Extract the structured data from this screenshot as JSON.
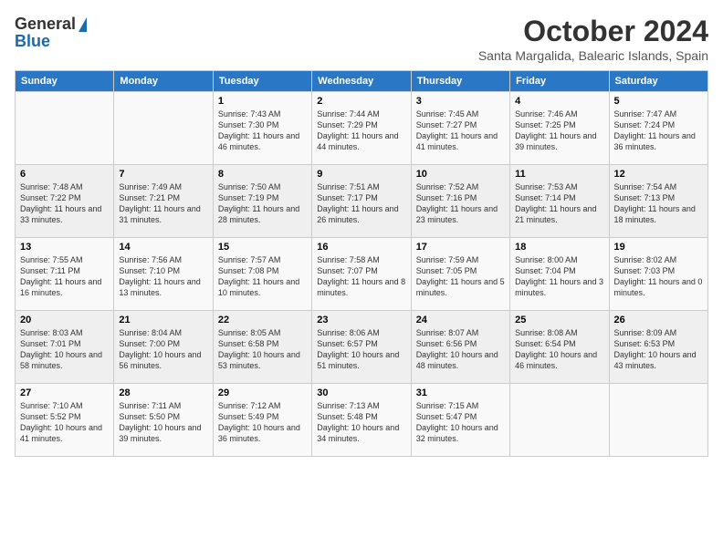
{
  "header": {
    "logo_general": "General",
    "logo_blue": "Blue",
    "month_title": "October 2024",
    "location": "Santa Margalida, Balearic Islands, Spain"
  },
  "days_of_week": [
    "Sunday",
    "Monday",
    "Tuesday",
    "Wednesday",
    "Thursday",
    "Friday",
    "Saturday"
  ],
  "weeks": [
    [
      {
        "day": "",
        "info": ""
      },
      {
        "day": "",
        "info": ""
      },
      {
        "day": "1",
        "info": "Sunrise: 7:43 AM\nSunset: 7:30 PM\nDaylight: 11 hours and 46 minutes."
      },
      {
        "day": "2",
        "info": "Sunrise: 7:44 AM\nSunset: 7:29 PM\nDaylight: 11 hours and 44 minutes."
      },
      {
        "day": "3",
        "info": "Sunrise: 7:45 AM\nSunset: 7:27 PM\nDaylight: 11 hours and 41 minutes."
      },
      {
        "day": "4",
        "info": "Sunrise: 7:46 AM\nSunset: 7:25 PM\nDaylight: 11 hours and 39 minutes."
      },
      {
        "day": "5",
        "info": "Sunrise: 7:47 AM\nSunset: 7:24 PM\nDaylight: 11 hours and 36 minutes."
      }
    ],
    [
      {
        "day": "6",
        "info": "Sunrise: 7:48 AM\nSunset: 7:22 PM\nDaylight: 11 hours and 33 minutes."
      },
      {
        "day": "7",
        "info": "Sunrise: 7:49 AM\nSunset: 7:21 PM\nDaylight: 11 hours and 31 minutes."
      },
      {
        "day": "8",
        "info": "Sunrise: 7:50 AM\nSunset: 7:19 PM\nDaylight: 11 hours and 28 minutes."
      },
      {
        "day": "9",
        "info": "Sunrise: 7:51 AM\nSunset: 7:17 PM\nDaylight: 11 hours and 26 minutes."
      },
      {
        "day": "10",
        "info": "Sunrise: 7:52 AM\nSunset: 7:16 PM\nDaylight: 11 hours and 23 minutes."
      },
      {
        "day": "11",
        "info": "Sunrise: 7:53 AM\nSunset: 7:14 PM\nDaylight: 11 hours and 21 minutes."
      },
      {
        "day": "12",
        "info": "Sunrise: 7:54 AM\nSunset: 7:13 PM\nDaylight: 11 hours and 18 minutes."
      }
    ],
    [
      {
        "day": "13",
        "info": "Sunrise: 7:55 AM\nSunset: 7:11 PM\nDaylight: 11 hours and 16 minutes."
      },
      {
        "day": "14",
        "info": "Sunrise: 7:56 AM\nSunset: 7:10 PM\nDaylight: 11 hours and 13 minutes."
      },
      {
        "day": "15",
        "info": "Sunrise: 7:57 AM\nSunset: 7:08 PM\nDaylight: 11 hours and 10 minutes."
      },
      {
        "day": "16",
        "info": "Sunrise: 7:58 AM\nSunset: 7:07 PM\nDaylight: 11 hours and 8 minutes."
      },
      {
        "day": "17",
        "info": "Sunrise: 7:59 AM\nSunset: 7:05 PM\nDaylight: 11 hours and 5 minutes."
      },
      {
        "day": "18",
        "info": "Sunrise: 8:00 AM\nSunset: 7:04 PM\nDaylight: 11 hours and 3 minutes."
      },
      {
        "day": "19",
        "info": "Sunrise: 8:02 AM\nSunset: 7:03 PM\nDaylight: 11 hours and 0 minutes."
      }
    ],
    [
      {
        "day": "20",
        "info": "Sunrise: 8:03 AM\nSunset: 7:01 PM\nDaylight: 10 hours and 58 minutes."
      },
      {
        "day": "21",
        "info": "Sunrise: 8:04 AM\nSunset: 7:00 PM\nDaylight: 10 hours and 56 minutes."
      },
      {
        "day": "22",
        "info": "Sunrise: 8:05 AM\nSunset: 6:58 PM\nDaylight: 10 hours and 53 minutes."
      },
      {
        "day": "23",
        "info": "Sunrise: 8:06 AM\nSunset: 6:57 PM\nDaylight: 10 hours and 51 minutes."
      },
      {
        "day": "24",
        "info": "Sunrise: 8:07 AM\nSunset: 6:56 PM\nDaylight: 10 hours and 48 minutes."
      },
      {
        "day": "25",
        "info": "Sunrise: 8:08 AM\nSunset: 6:54 PM\nDaylight: 10 hours and 46 minutes."
      },
      {
        "day": "26",
        "info": "Sunrise: 8:09 AM\nSunset: 6:53 PM\nDaylight: 10 hours and 43 minutes."
      }
    ],
    [
      {
        "day": "27",
        "info": "Sunrise: 7:10 AM\nSunset: 5:52 PM\nDaylight: 10 hours and 41 minutes."
      },
      {
        "day": "28",
        "info": "Sunrise: 7:11 AM\nSunset: 5:50 PM\nDaylight: 10 hours and 39 minutes."
      },
      {
        "day": "29",
        "info": "Sunrise: 7:12 AM\nSunset: 5:49 PM\nDaylight: 10 hours and 36 minutes."
      },
      {
        "day": "30",
        "info": "Sunrise: 7:13 AM\nSunset: 5:48 PM\nDaylight: 10 hours and 34 minutes."
      },
      {
        "day": "31",
        "info": "Sunrise: 7:15 AM\nSunset: 5:47 PM\nDaylight: 10 hours and 32 minutes."
      },
      {
        "day": "",
        "info": ""
      },
      {
        "day": "",
        "info": ""
      }
    ]
  ]
}
